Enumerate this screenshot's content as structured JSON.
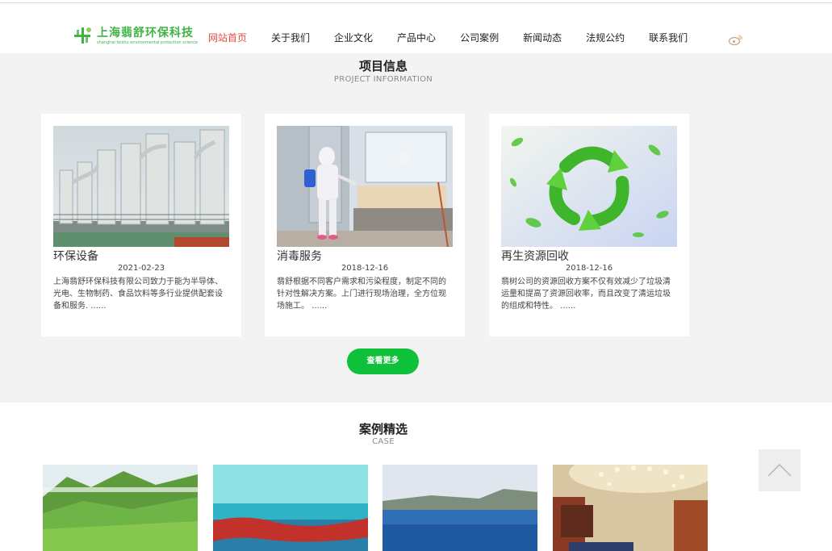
{
  "header": {
    "logo_title": "上海翡舒环保科技",
    "logo_subtitle": "shanghai feishu environmental protection science",
    "nav": [
      {
        "label": "网站首页",
        "active": true
      },
      {
        "label": "关于我们",
        "active": false
      },
      {
        "label": "企业文化",
        "active": false
      },
      {
        "label": "产品中心",
        "active": false
      },
      {
        "label": "公司案例",
        "active": false
      },
      {
        "label": "新闻动态",
        "active": false
      },
      {
        "label": "法规公约",
        "active": false
      },
      {
        "label": "联系我们",
        "active": false
      }
    ],
    "social_icon": "weibo-icon"
  },
  "project": {
    "title": "项目信息",
    "subtitle": "PROJECT INFORMATION",
    "cards": [
      {
        "title": "环保设备",
        "date": "2021-02-23",
        "desc": "上海翡舒环保科技有限公司致力于能为半导体、光电、生物制药、食品饮料等多行业提供配套设备和服务. ......"
      },
      {
        "title": "消毒服务",
        "date": "2018-12-16",
        "desc": "翡舒根据不同客户需求和污染程度，制定不同的针对性解决方案。上门进行现场治理，全方位现场施工。 ......"
      },
      {
        "title": "再生资源回收",
        "date": "2018-12-16",
        "desc": "翡树公司的资源回收方案不仅有效减少了垃圾清运量和提高了资源回收率，而且改变了清运垃圾的组成和特性。 ......"
      }
    ],
    "more_label": "查看更多"
  },
  "case": {
    "title": "案例精选",
    "subtitle": "CASE"
  },
  "colors": {
    "brand_green": "#3fb344",
    "button_green": "#0fc13a",
    "nav_active": "#e64c3c",
    "section_bg": "#f3f3f3"
  }
}
